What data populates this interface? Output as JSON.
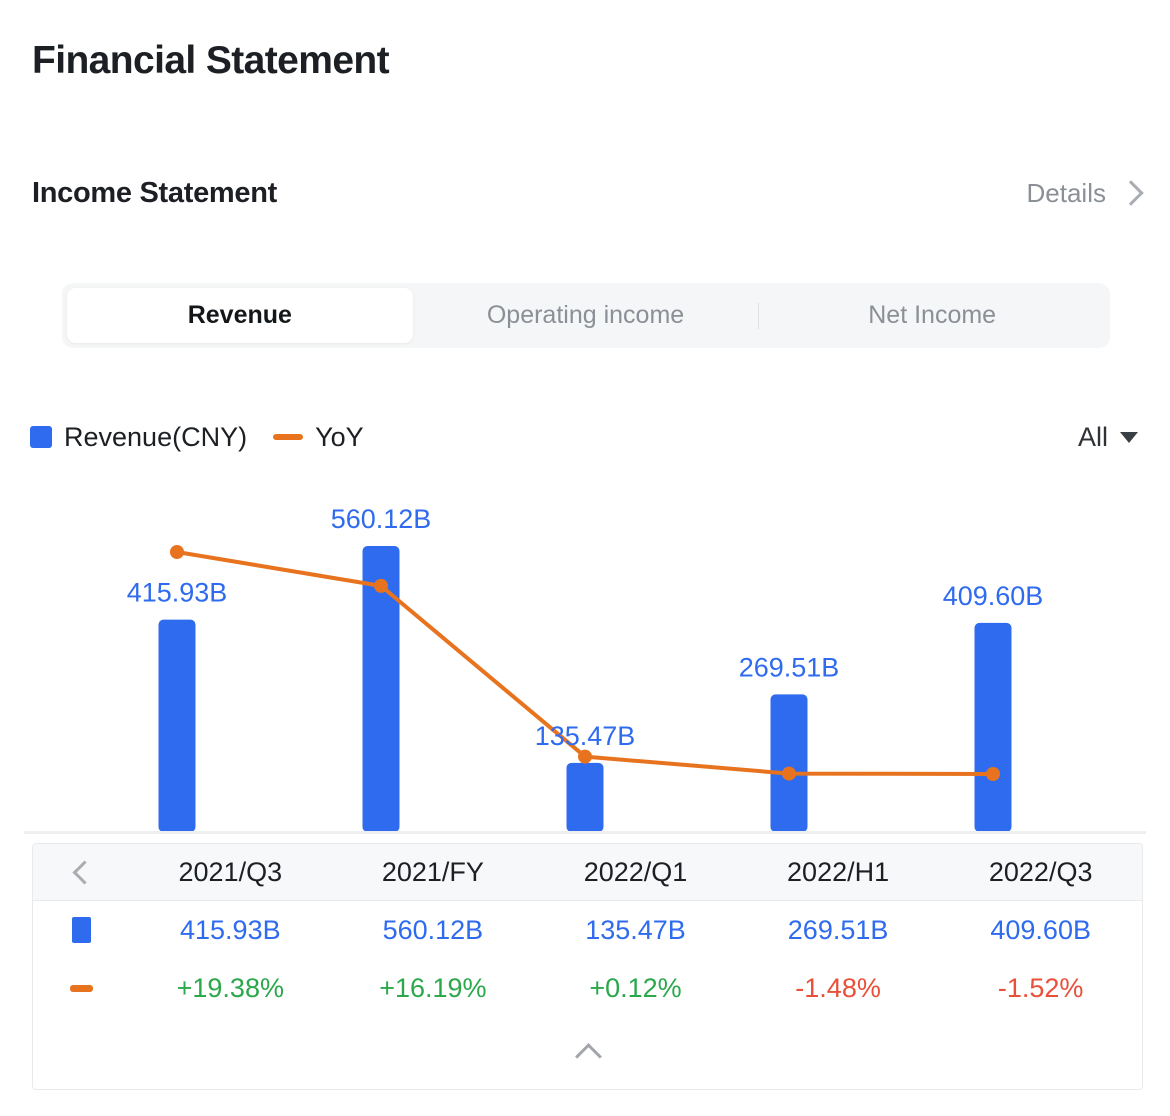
{
  "page_title": "Financial Statement",
  "section": {
    "title": "Income Statement",
    "details_label": "Details",
    "chevron_icon": "chevron-right-icon"
  },
  "tabs": [
    {
      "label": "Revenue",
      "active": true
    },
    {
      "label": "Operating income",
      "active": false
    },
    {
      "label": "Net Income",
      "active": false
    }
  ],
  "legend": {
    "bar_label": "Revenue(CNY)",
    "line_label": "YoY",
    "bar_color": "#2f6bef",
    "line_color": "#e8731f",
    "range_value": "All",
    "caret_icon": "chevron-down-icon"
  },
  "chart_data": {
    "type": "bar",
    "title": "Revenue(CNY)",
    "xlabel": "",
    "ylabel": "",
    "grid": false,
    "legend_position": "top-left",
    "categories": [
      "2021/Q3",
      "2021/FY",
      "2022/Q1",
      "2022/H1",
      "2022/Q3"
    ],
    "series": [
      {
        "name": "Revenue(CNY)",
        "type": "bar",
        "color": "#2f6bef",
        "unit": "B",
        "values": [
          415.93,
          560.12,
          135.47,
          269.51,
          409.6
        ],
        "labels": [
          "415.93B",
          "560.12B",
          "135.47B",
          "269.51B",
          "409.60B"
        ]
      },
      {
        "name": "YoY",
        "type": "line",
        "color": "#e8731f",
        "unit": "%",
        "values": [
          19.38,
          16.19,
          0.12,
          -1.48,
          -1.52
        ],
        "labels": [
          "+19.38%",
          "+16.19%",
          "+0.12%",
          "-1.48%",
          "-1.52%"
        ]
      }
    ]
  },
  "table": {
    "prev_icon": "chevron-left-icon",
    "collapse_icon": "chevron-up-icon",
    "headers": [
      "2021/Q3",
      "2021/FY",
      "2022/Q1",
      "2022/H1",
      "2022/Q3"
    ],
    "rows": [
      {
        "marker": "bar-swatch",
        "values": [
          "415.93B",
          "560.12B",
          "135.47B",
          "269.51B",
          "409.60B"
        ],
        "tones": [
          "blue",
          "blue",
          "blue",
          "blue",
          "blue"
        ]
      },
      {
        "marker": "line-swatch",
        "values": [
          "+19.38%",
          "+16.19%",
          "+0.12%",
          "-1.48%",
          "-1.52%"
        ],
        "tones": [
          "up",
          "up",
          "up",
          "down",
          "down"
        ]
      }
    ]
  }
}
